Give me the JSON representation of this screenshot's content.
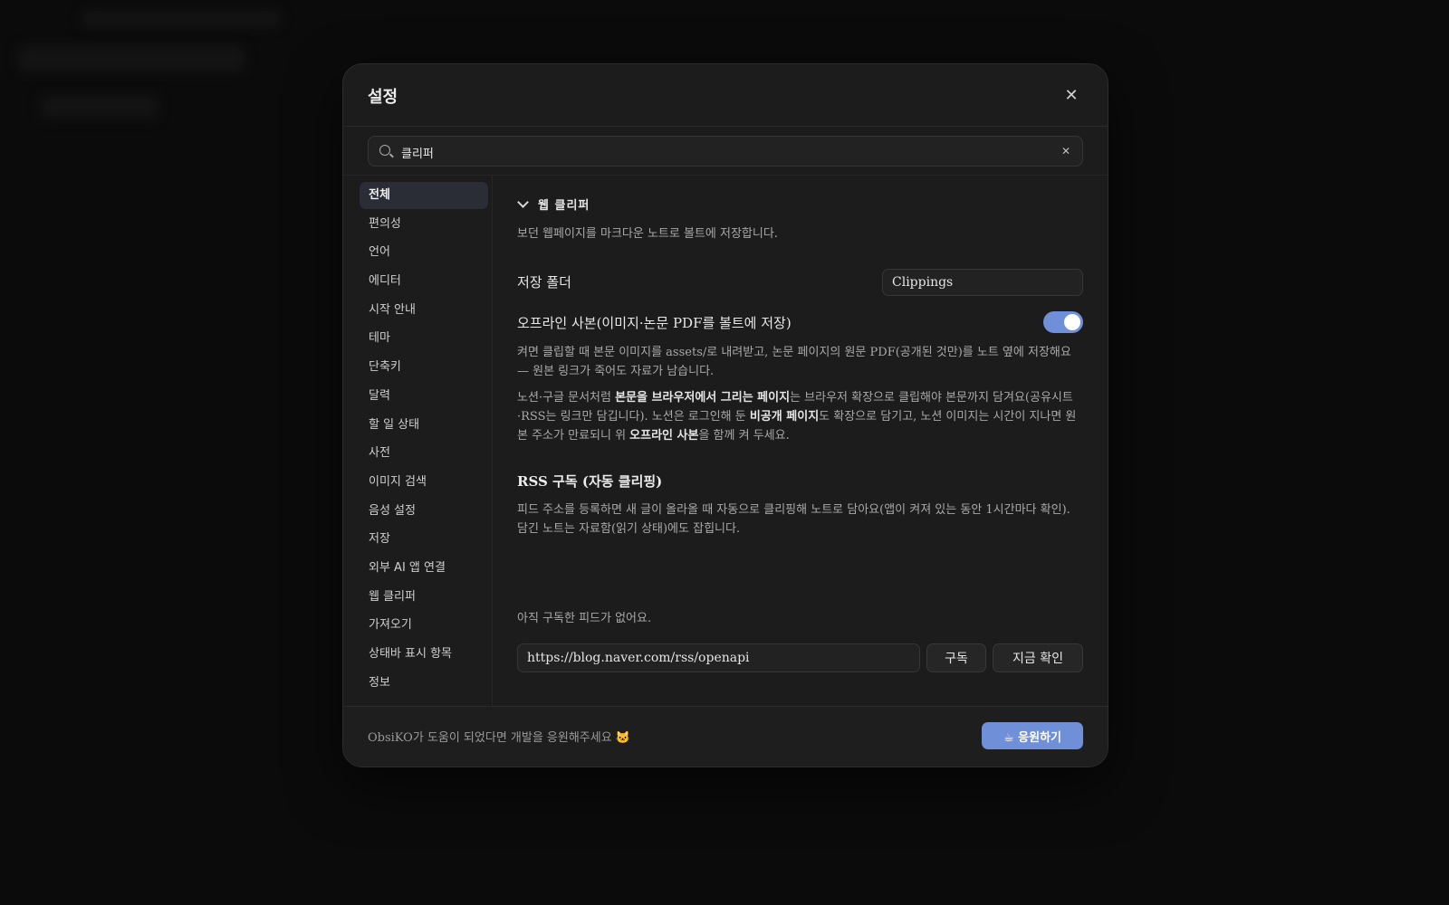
{
  "modal": {
    "title": "설정",
    "close_icon": "close-icon"
  },
  "search": {
    "value": "클리퍼",
    "icon": "search-icon",
    "clear_icon": "close-icon"
  },
  "sidebar": {
    "items": [
      {
        "label": "전체",
        "active": true
      },
      {
        "label": "편의성"
      },
      {
        "label": "언어"
      },
      {
        "label": "에디터"
      },
      {
        "label": "시작 안내"
      },
      {
        "label": "테마"
      },
      {
        "label": "단축키"
      },
      {
        "label": "달력"
      },
      {
        "label": "할 일 상태"
      },
      {
        "label": "사전"
      },
      {
        "label": "이미지 검색"
      },
      {
        "label": "음성 설정"
      },
      {
        "label": "저장"
      },
      {
        "label": "외부 AI 앱 연결"
      },
      {
        "label": "웹 클리퍼"
      },
      {
        "label": "가져오기"
      },
      {
        "label": "상태바 표시 항목"
      },
      {
        "label": "정보"
      }
    ]
  },
  "content": {
    "section_title": "웹 클리퍼",
    "section_desc": "보던 웹페이지를 마크다운 노트로 볼트에 저장합니다.",
    "save_folder_label": "저장 폴더",
    "save_folder_value": "Clippings",
    "offline_label": "오프라인 사본(이미지·논문 PDF를 볼트에 저장)",
    "offline_enabled": true,
    "offline_desc": "켜면 클립할 때 본문 이미지를 assets/로 내려받고, 논문 페이지의 원문 PDF(공개된 것만)를 노트 옆에 저장해요 — 원본 링크가 죽어도 자료가 남습니다.",
    "notion_desc_1": "노션·구글 문서처럼 ",
    "notion_desc_bold_1": "본문을 브라우저에서 그리는 페이지",
    "notion_desc_2": "는 브라우저 확장으로 클립해야 본문까지 담겨요(공유시트·RSS는 링크만 담깁니다). 노션은 로그인해 둔 ",
    "notion_desc_bold_2": "비공개 페이지",
    "notion_desc_3": "도 확장으로 담기고, 노션 이미지는 시간이 지나면 원본 주소가 만료되니 위 ",
    "notion_desc_bold_3": "오프라인 사본",
    "notion_desc_4": "을 함께 켜 두세요.",
    "rss_title": "RSS 구독 (자동 클리핑)",
    "rss_desc": "피드 주소를 등록하면 새 글이 올라올 때 자동으로 클리핑해 노트로 담아요(앱이 켜져 있는 동안 1시간마다 확인). 담긴 노트는 자료함(읽기 상태)에도 잡힙니다.",
    "rss_empty": "아직 구독한 피드가 없어요.",
    "rss_input_value": "https://blog.naver.com/rss/openapi",
    "subscribe_label": "구독",
    "check_now_label": "지금 확인"
  },
  "footer": {
    "text": "ObsiKO가 도움이 되었다면 개발을 응원해주세요 🐱",
    "support_label": "☕ 응원하기"
  },
  "colors": {
    "accent": "#6f8fd8",
    "modal_bg": "#1c1c1c",
    "backdrop": "#0b0b0b"
  }
}
